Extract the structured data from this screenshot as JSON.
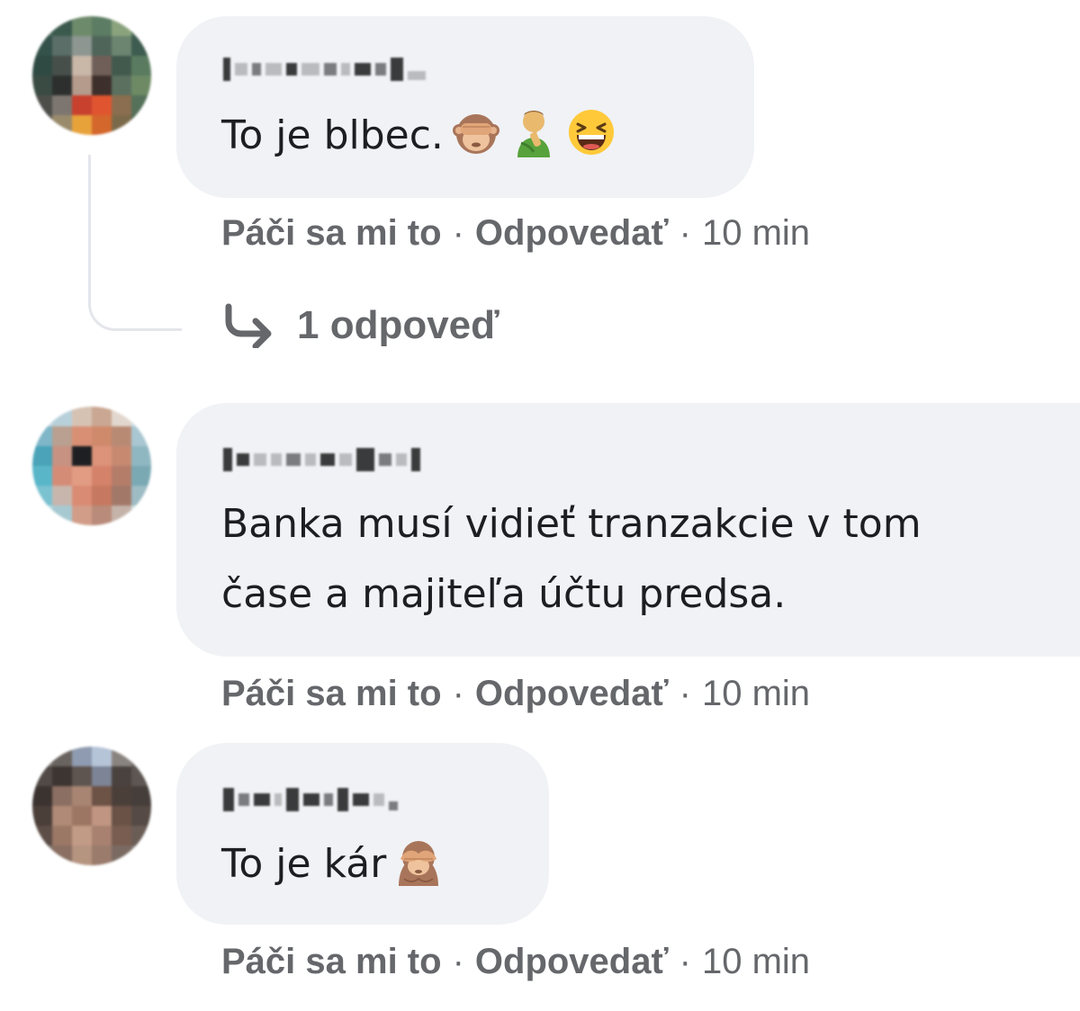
{
  "comments": [
    {
      "text": "To je blbec.",
      "emojis": [
        "see-no-evil-monkey",
        "person-facepalming",
        "grinning-squinting-face"
      ],
      "actions": {
        "like": "Páči sa mi to",
        "reply": "Odpovedať",
        "separator": "·",
        "time": "10 min"
      },
      "replies_link": "1 odpoveď"
    },
    {
      "text_lines": [
        "Banka musí vidieť tranzakcie v tom",
        "čase a majiteľa účtu predsa."
      ],
      "actions": {
        "like": "Páči sa mi to",
        "reply": "Odpovedať",
        "separator": "·",
        "time": "10 min"
      }
    },
    {
      "text": "To je kár",
      "emojis": [
        "see-no-evil-monkey"
      ],
      "actions": {
        "like": "Páči sa mi to",
        "reply": "Odpovedať",
        "separator": "·",
        "time": "10 min"
      }
    }
  ],
  "colors": {
    "bubble": "#f0f2f5",
    "action_text": "#65676b",
    "comment_text": "#1c1e21",
    "thread_line": "#e4e6eb"
  },
  "icons": {
    "reply_arrow": "reply-arrow-icon"
  }
}
